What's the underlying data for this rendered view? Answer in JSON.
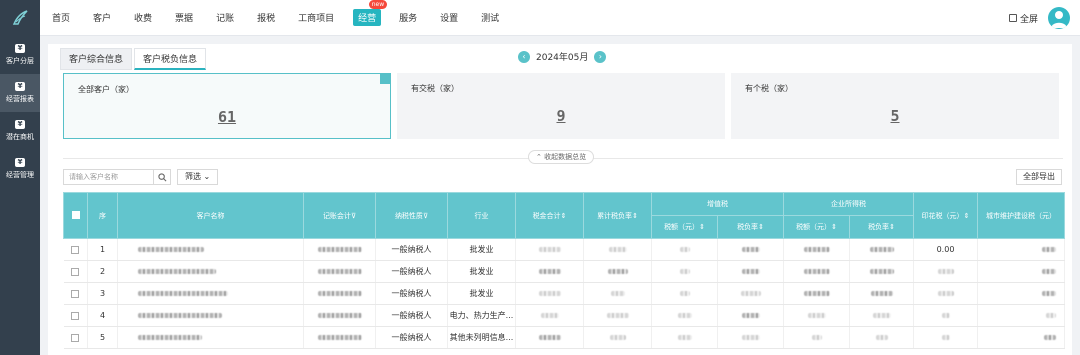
{
  "nav": {
    "items": [
      "首页",
      "客户",
      "收费",
      "票据",
      "记账",
      "报税",
      "工商项目",
      "经营",
      "服务",
      "设置",
      "测试"
    ],
    "active_index": 7,
    "new_badge": "new",
    "fullscreen_label": "全屏"
  },
  "sidebar": {
    "items": [
      {
        "label": "客户分层",
        "icon": "yen-icon"
      },
      {
        "label": "经营报表",
        "icon": "yen-icon"
      },
      {
        "label": "潜在商机",
        "icon": "yen-icon"
      },
      {
        "label": "经营管理",
        "icon": "yen-icon"
      }
    ],
    "active_index": 1,
    "icon_glyph": "¥"
  },
  "tabs": [
    "客户综合信息",
    "客户税负信息"
  ],
  "month": {
    "prev": "‹",
    "label": "2024年05月",
    "next": "›"
  },
  "cards": [
    {
      "label": "全部客户（家）",
      "value": "61"
    },
    {
      "label": "有交税（家）",
      "value": "9"
    },
    {
      "label": "有个税（家）",
      "value": "5"
    }
  ],
  "collapse_label": "收起数据总览",
  "search": {
    "placeholder": "请输入客户名称"
  },
  "filter_label": "筛选",
  "export_label": "全部导出",
  "table": {
    "group_headers": {
      "vat": "增值税",
      "cit": "企业所得税"
    },
    "headers": {
      "index": "序",
      "name": "客户名称",
      "bookkeeper": "记账会计",
      "taxpayer": "纳税性质",
      "industry": "行业",
      "tax_total": "税金合计",
      "burden": "累计税负率",
      "vat_amount": "税额（元）",
      "vat_rate": "税负率",
      "cit_amount": "税额（元）",
      "cit_rate": "税负率",
      "stamp": "印花税（元）",
      "urban": "城市维护建设税（元）"
    },
    "rows": [
      {
        "index": "1",
        "taxpayer": "一般纳税人",
        "industry": "批发业",
        "stamp": "0.00"
      },
      {
        "index": "2",
        "taxpayer": "一般纳税人",
        "industry": "批发业",
        "stamp": ""
      },
      {
        "index": "3",
        "taxpayer": "一般纳税人",
        "industry": "批发业",
        "stamp": ""
      },
      {
        "index": "4",
        "taxpayer": "一般纳税人",
        "industry": "电力、热力生产...",
        "stamp": ""
      },
      {
        "index": "5",
        "taxpayer": "一般纳税人",
        "industry": "其他未列明信息...",
        "stamp": ""
      }
    ]
  }
}
